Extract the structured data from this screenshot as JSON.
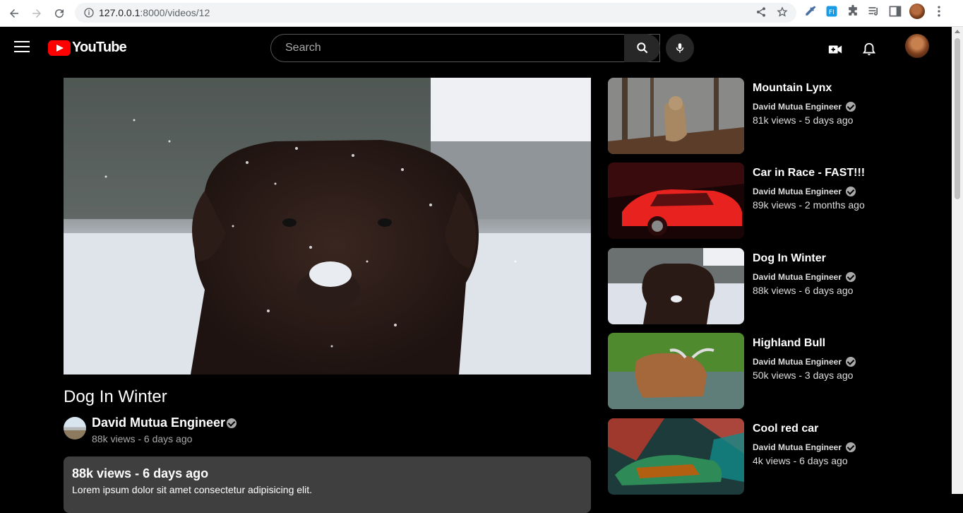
{
  "browser": {
    "url_host": "127.0.0.1",
    "url_path": ":8000/videos/12"
  },
  "header": {
    "logo_text": "YouTube",
    "search_placeholder": "Search"
  },
  "video": {
    "title": "Dog In Winter",
    "channel": "David Mutua Engineer",
    "meta": "88k views - 6 days ago",
    "desc_stats": "88k views - 6 days ago",
    "desc_text": "Lorem ipsum dolor sit amet consectetur adipisicing elit."
  },
  "sidebar": {
    "items": [
      {
        "title": "Mountain Lynx",
        "channel": "David Mutua Engineer",
        "meta": "81k views - 5 days ago"
      },
      {
        "title": "Car in Race - FAST!!!",
        "channel": "David Mutua Engineer",
        "meta": "89k views - 2 months ago"
      },
      {
        "title": "Dog In Winter",
        "channel": "David Mutua Engineer",
        "meta": "88k views - 6 days ago"
      },
      {
        "title": "Highland Bull",
        "channel": "David Mutua Engineer",
        "meta": "50k views - 3 days ago"
      },
      {
        "title": "Cool red car",
        "channel": "David Mutua Engineer",
        "meta": "4k views - 6 days ago"
      }
    ]
  },
  "colors": {
    "brand_red": "#ff0000",
    "background": "#000000",
    "panel": "#3f3f3f"
  }
}
